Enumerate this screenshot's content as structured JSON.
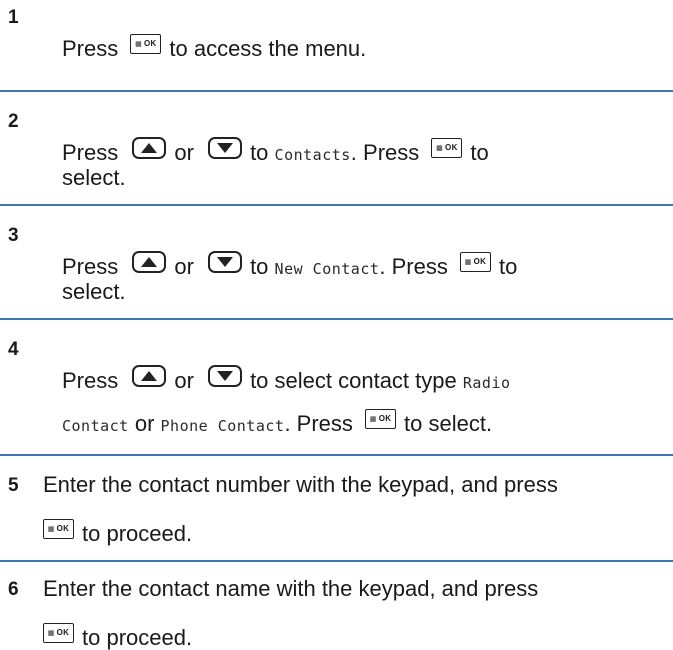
{
  "icons": {
    "ok_key_label": "OK",
    "ok_key_grid": "▦",
    "up_key": "up-arrow-key",
    "down_key": "down-arrow-key"
  },
  "colors": {
    "rule": "#3a78b8",
    "text": "#1a1a1a"
  },
  "steps": [
    {
      "number": "1",
      "press": "Press",
      "to_access": "to access the menu."
    },
    {
      "number": "2",
      "press": "Press",
      "or": "or",
      "to": "to",
      "menu_item": "Contacts",
      "press2": ". Press",
      "to_end": "to",
      "select": "select."
    },
    {
      "number": "3",
      "press": "Press",
      "or": "or",
      "to": "to",
      "menu_item": "New Contact",
      "press2": ". Press",
      "to_end": "to",
      "select": "select."
    },
    {
      "number": "4",
      "press": "Press",
      "or": "or",
      "to_select": "to select contact type",
      "opt1a": "Radio",
      "opt1b": "Contact",
      "or2": "or",
      "opt2": "Phone Contact",
      "press2": ". Press",
      "to_select2": "to select."
    },
    {
      "number": "5",
      "line1": "Enter the contact number with the keypad, and press",
      "to_proceed": "to proceed."
    },
    {
      "number": "6",
      "line1": "Enter the contact name with the keypad, and press",
      "to_proceed": "to proceed."
    }
  ]
}
